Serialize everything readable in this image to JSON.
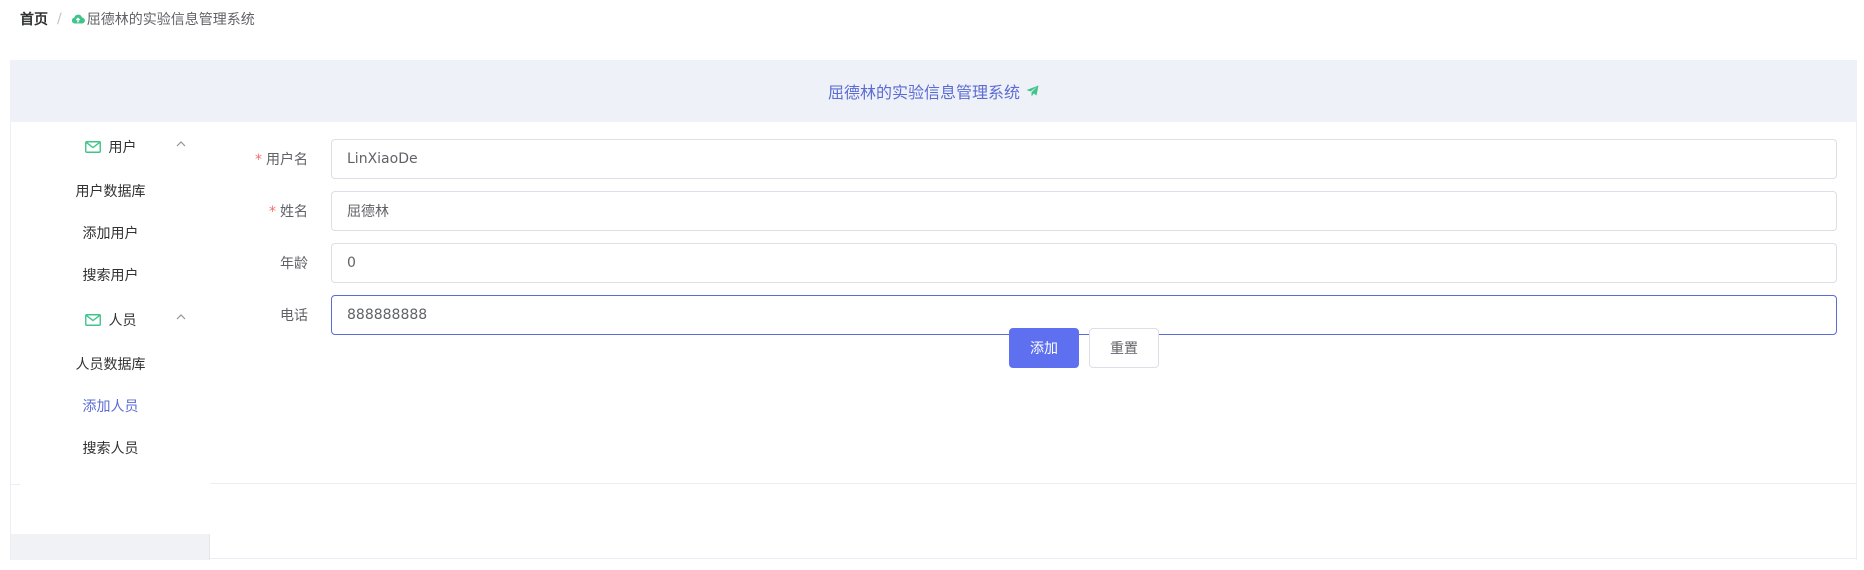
{
  "breadcrumb": {
    "home": "首页",
    "separator": "/",
    "current": "屈德林的实验信息管理系统",
    "current_icon": "cloud-upload-icon"
  },
  "header": {
    "title": "屈德林的实验信息管理系统",
    "icon": "paper-plane-icon"
  },
  "sidebar": {
    "groups": [
      {
        "title": "用户",
        "icon": "mail-icon",
        "expanded": true,
        "items": [
          {
            "label": "用户数据库",
            "active": false
          },
          {
            "label": "添加用户",
            "active": false
          },
          {
            "label": "搜索用户",
            "active": false
          }
        ]
      },
      {
        "title": "人员",
        "icon": "mail-icon",
        "expanded": true,
        "items": [
          {
            "label": "人员数据库",
            "active": false
          },
          {
            "label": "添加人员",
            "active": true
          },
          {
            "label": "搜索人员",
            "active": false
          }
        ]
      }
    ]
  },
  "form": {
    "fields": [
      {
        "label": "用户名",
        "required": "*",
        "value": "LinXiaoDe"
      },
      {
        "label": "姓名",
        "required": "*",
        "value": "屈德林"
      },
      {
        "label": "年龄",
        "required": "",
        "value": "0"
      },
      {
        "label": "电话",
        "required": "",
        "value": "888888888"
      }
    ],
    "submit_label": "添加",
    "reset_label": "重置"
  },
  "colors": {
    "accent": "#5b6cd4",
    "primary_button": "#5e70f0",
    "icon_green": "#41c48c",
    "required": "#f56c6c",
    "header_bg": "#eef1f8"
  }
}
